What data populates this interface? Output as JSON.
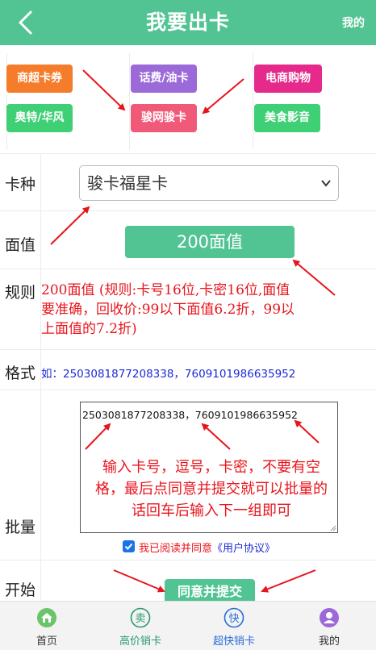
{
  "header": {
    "title": "我要出卡",
    "right_link": "我的"
  },
  "categories": [
    {
      "label": "商超卡券",
      "color": "#f57c2a"
    },
    {
      "label": "话费/油卡",
      "color": "#9b6ad8"
    },
    {
      "label": "电商购物",
      "color": "#e52a8c"
    },
    {
      "label": "奥特/华风",
      "color": "#3fcf74"
    },
    {
      "label": "骏网骏卡",
      "color": "#f05a78"
    },
    {
      "label": "美食影音",
      "color": "#3fcf74"
    }
  ],
  "form": {
    "card_type": {
      "label": "卡种",
      "selected": "骏卡福星卡"
    },
    "face_value": {
      "label": "面值",
      "button": "200面值"
    },
    "rules": {
      "label": "规则",
      "text": "200面值 (规则:卡号16位,卡密16位,面值要准确，回收价:99以下面值6.2折，99以上面值的7.2折)"
    },
    "format": {
      "label": "格式",
      "text": "如：2503081877208338，7609101986635952"
    },
    "batch": {
      "label": "批量",
      "value": "2503081877208338，7609101986635952",
      "hint": "输入卡号，逗号，卡密，不要有空格，最后点同意并提交就可以批量的话回车后输入下一组即可"
    },
    "agreement": {
      "text": "我已阅读并同意",
      "link": "《用户协议》",
      "checked": true
    },
    "start": {
      "label": "开始",
      "submit": "同意并提交"
    }
  },
  "tabs": [
    {
      "label": "首页",
      "icon": "home-icon",
      "color": "#6bc36a",
      "text_color": "#333333"
    },
    {
      "label": "高价销卡",
      "icon": "sell-icon",
      "color": "#2a9a6e",
      "text_color": "#2a9a6e"
    },
    {
      "label": "超快销卡",
      "icon": "fast-icon",
      "color": "#2a6ed8",
      "text_color": "#2a6ed8"
    },
    {
      "label": "我的",
      "icon": "user-icon",
      "color": "#9b6ad8",
      "text_color": "#333333"
    }
  ],
  "tab_glyphs": {
    "sell": "卖",
    "fast": "快"
  },
  "colors": {
    "brand_green": "#52c494",
    "annotation_red": "#e8141c",
    "link_blue": "#1d2ad6"
  }
}
